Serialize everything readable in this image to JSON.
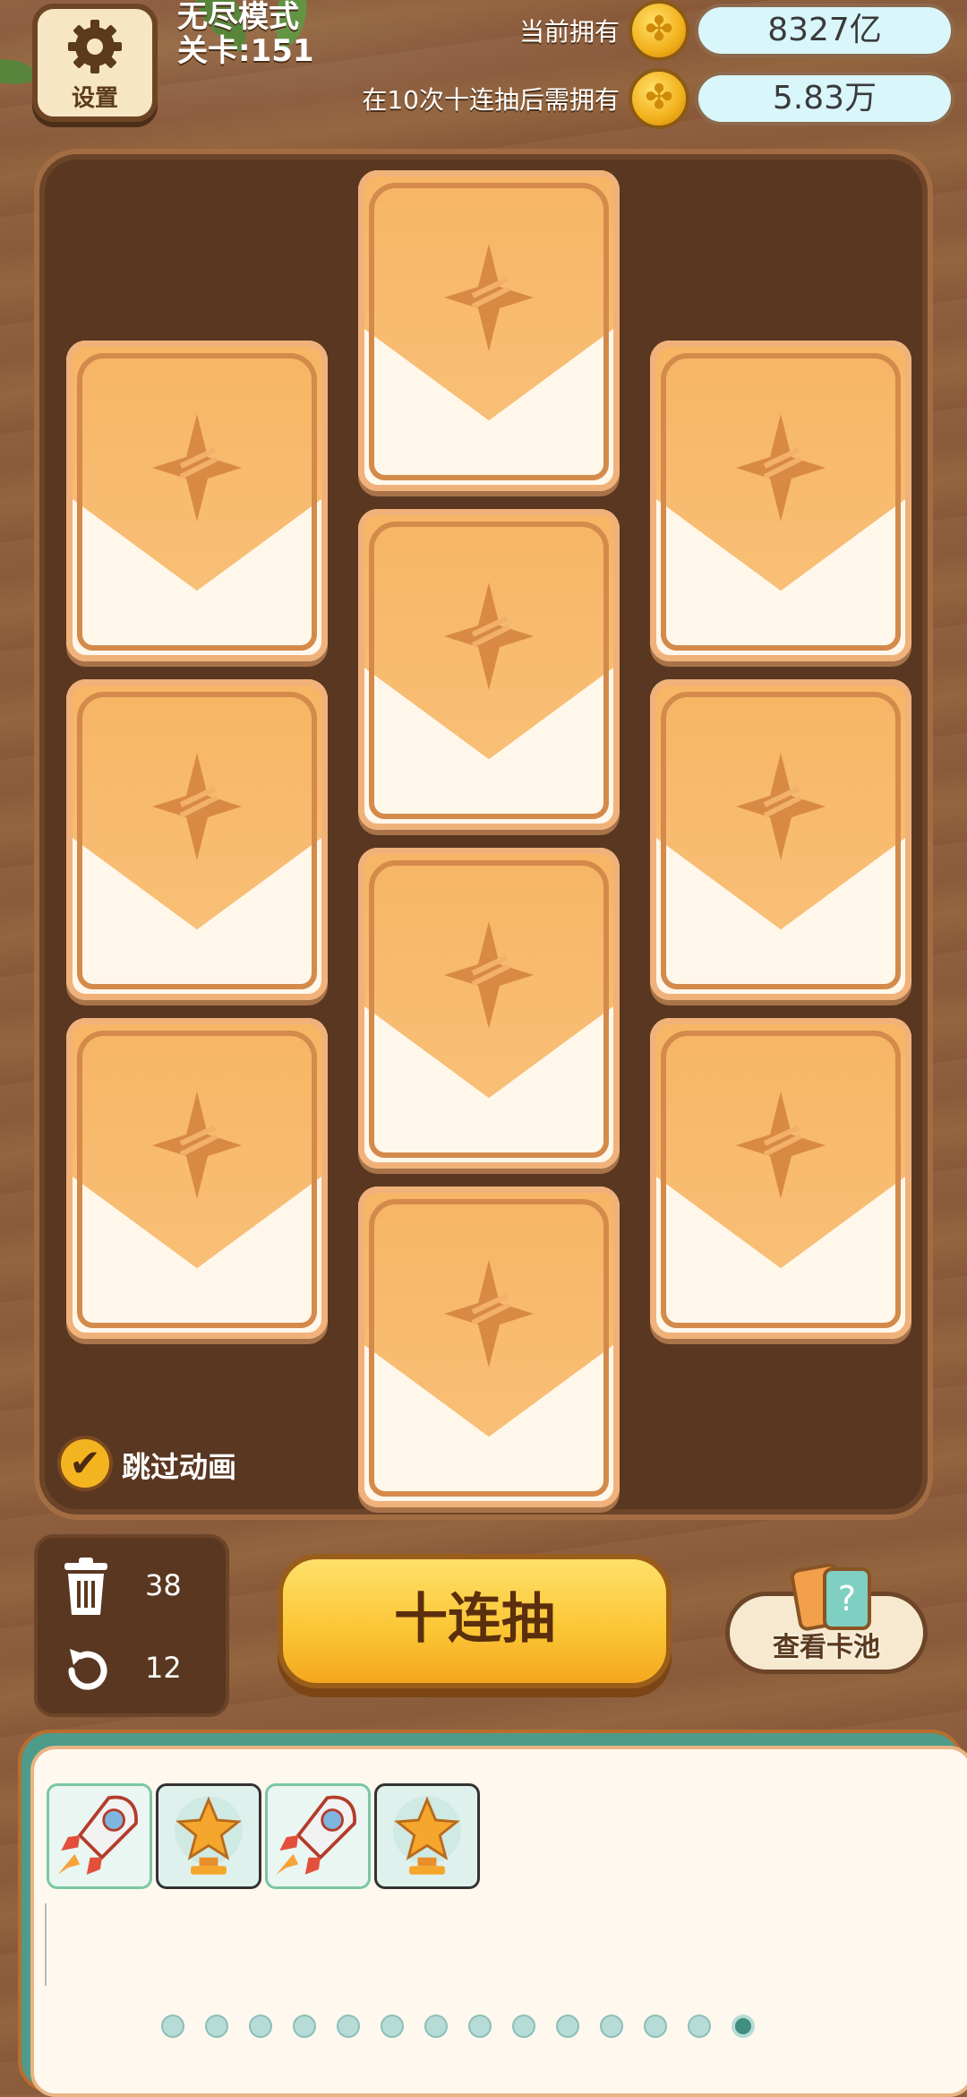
{
  "header": {
    "settings_label": "设置",
    "mode": "无尽模式",
    "level": "关卡:151",
    "current_label": "当前拥有",
    "current_value": "8327亿",
    "required_label": "在10次十连抽后需拥有",
    "required_value": "5.83万"
  },
  "board": {
    "card_count": 10,
    "skip_animation_label": "跳过动画",
    "skip_animation_checked": true
  },
  "controls": {
    "trash_count": "38",
    "undo_count": "12",
    "draw_button_label": "十连抽",
    "pool_button_label": "查看卡池"
  },
  "tray": {
    "items": [
      {
        "icon": "rocket-icon"
      },
      {
        "icon": "star-trophy-icon"
      },
      {
        "icon": "rocket-icon"
      },
      {
        "icon": "star-trophy-icon"
      }
    ],
    "page_count": 14,
    "active_page": 14
  },
  "colors": {
    "card_orange": "#f7b565",
    "button_yellow": "#fbc736",
    "board_brown": "#5a3720",
    "tray_teal": "#4f9b8a"
  }
}
